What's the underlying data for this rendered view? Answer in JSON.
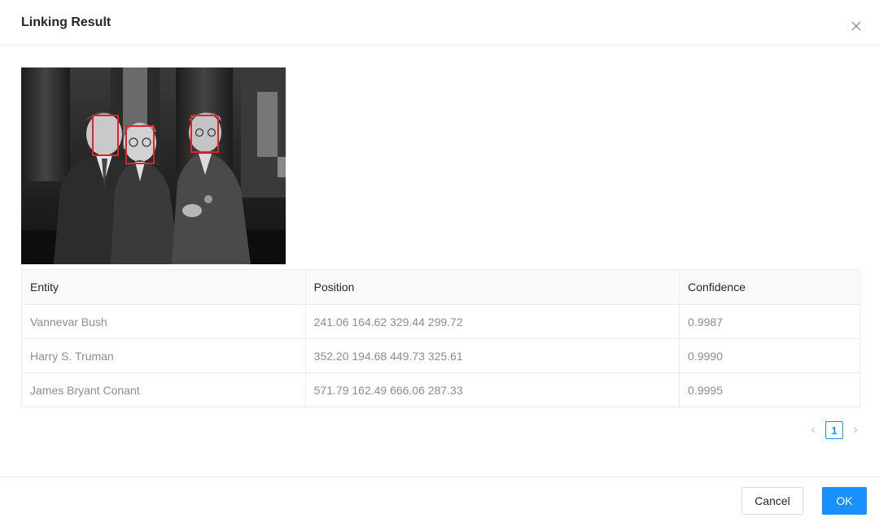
{
  "dialog": {
    "title": "Linking Result"
  },
  "image": {
    "description_icon": "group-photo-image",
    "face_box_color": "#e02424"
  },
  "table": {
    "headers": [
      "Entity",
      "Position",
      "Confidence"
    ],
    "rows": [
      {
        "entity": "Vannevar Bush",
        "position": "241.06 164.62 329.44 299.72",
        "confidence": "0.9987"
      },
      {
        "entity": "Harry S. Truman",
        "position": "352.20 194.68 449.73 325.61",
        "confidence": "0.9990"
      },
      {
        "entity": "James Bryant Conant",
        "position": "571.79 162.49 666.06 287.33",
        "confidence": "0.9995"
      }
    ]
  },
  "pagination": {
    "current_page": "1",
    "prev_icon": "chevron-left-icon",
    "next_icon": "chevron-right-icon"
  },
  "footer": {
    "cancel_label": "Cancel",
    "ok_label": "OK"
  },
  "colors": {
    "primary": "#1890ff",
    "border": "#ececec"
  }
}
